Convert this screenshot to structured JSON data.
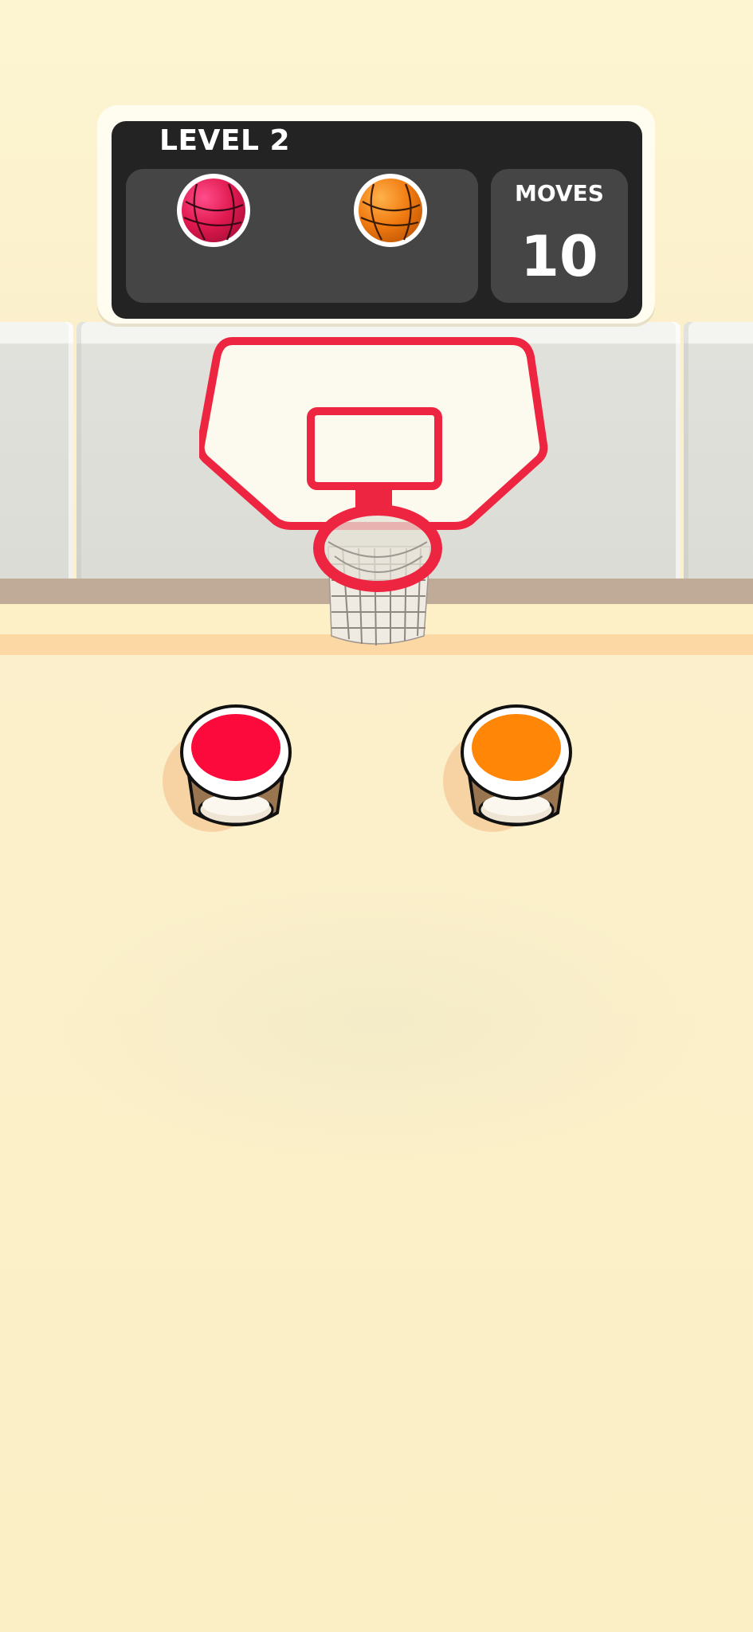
{
  "game": {
    "level_label": "LEVEL 2",
    "moves_label": "MOVES",
    "moves_value": "10"
  },
  "target_balls": [
    {
      "color_name": "red",
      "color": "#e0194f"
    },
    {
      "color_name": "orange",
      "color": "#f07a10"
    }
  ],
  "cups": [
    {
      "color_name": "red",
      "color": "#fb0a3b"
    },
    {
      "color_name": "orange",
      "color": "#ff8606"
    }
  ],
  "palette": {
    "background": "#fbf0cb",
    "hoop_red": "#ee2540",
    "scoreboard": "#232323",
    "scoreboard_panel": "#454545"
  }
}
